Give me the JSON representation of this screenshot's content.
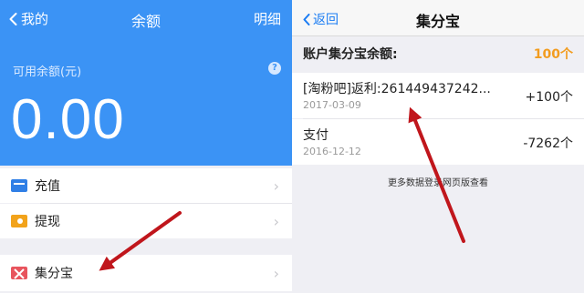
{
  "left": {
    "nav": {
      "back_label": "我的",
      "title": "余额",
      "detail_label": "明细"
    },
    "available_label": "可用余额(元)",
    "help_icon_glyph": "?",
    "balance": "0.00",
    "menu": [
      {
        "label": "充值",
        "icon": "recharge-card-icon",
        "chevron": "›"
      },
      {
        "label": "提现",
        "icon": "withdraw-wallet-icon",
        "chevron": "›"
      },
      {
        "label": "集分宝",
        "icon": "jifenbao-icon",
        "chevron": "›"
      }
    ]
  },
  "right": {
    "nav": {
      "back_label": "返回",
      "title": "集分宝"
    },
    "account": {
      "label": "账户集分宝余额:",
      "value": "100个"
    },
    "transactions": [
      {
        "title": "[淘粉吧]返利:261449437242...",
        "date": "2017-03-09",
        "amount": "+100个"
      },
      {
        "title": "支付",
        "date": "2016-12-12",
        "amount": "-7262个"
      }
    ],
    "more_text": "更多数据登录网页版查看"
  },
  "colors": {
    "primary_blue": "#3b93f5",
    "link_blue": "#1a7cf3",
    "accent_orange": "#f29c1f",
    "arrow_red": "#c0161c"
  }
}
